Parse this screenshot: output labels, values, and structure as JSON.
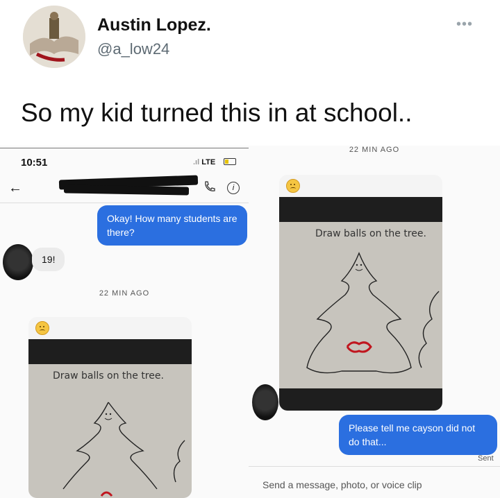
{
  "tweet": {
    "author_name": "Austin Lopez.",
    "handle": "@a_low24",
    "more_icon": "more-horizontal-icon",
    "text": "So my kid turned this in at school.."
  },
  "left_screenshot": {
    "status_bar": {
      "time": "10:51",
      "network": "LTE"
    },
    "messages": [
      {
        "direction": "outgoing",
        "text": "Okay! How many students are there?"
      },
      {
        "direction": "incoming",
        "text": "19!"
      }
    ],
    "timestamp": "22 MIN AGO",
    "image_caption": "Draw balls on the tree."
  },
  "right_screenshot": {
    "timestamp": "22 MIN AGO",
    "image_caption": "Draw balls on the tree.",
    "messages": [
      {
        "direction": "outgoing",
        "text": "Please tell me cayson did not do that..."
      }
    ],
    "sent_label": "Sent",
    "compose_placeholder": "Send a message, photo, or voice clip"
  },
  "colors": {
    "bubble_outgoing": "#2b6fe0",
    "bubble_incoming": "#ebebeb",
    "ink_red": "#c0161f"
  }
}
